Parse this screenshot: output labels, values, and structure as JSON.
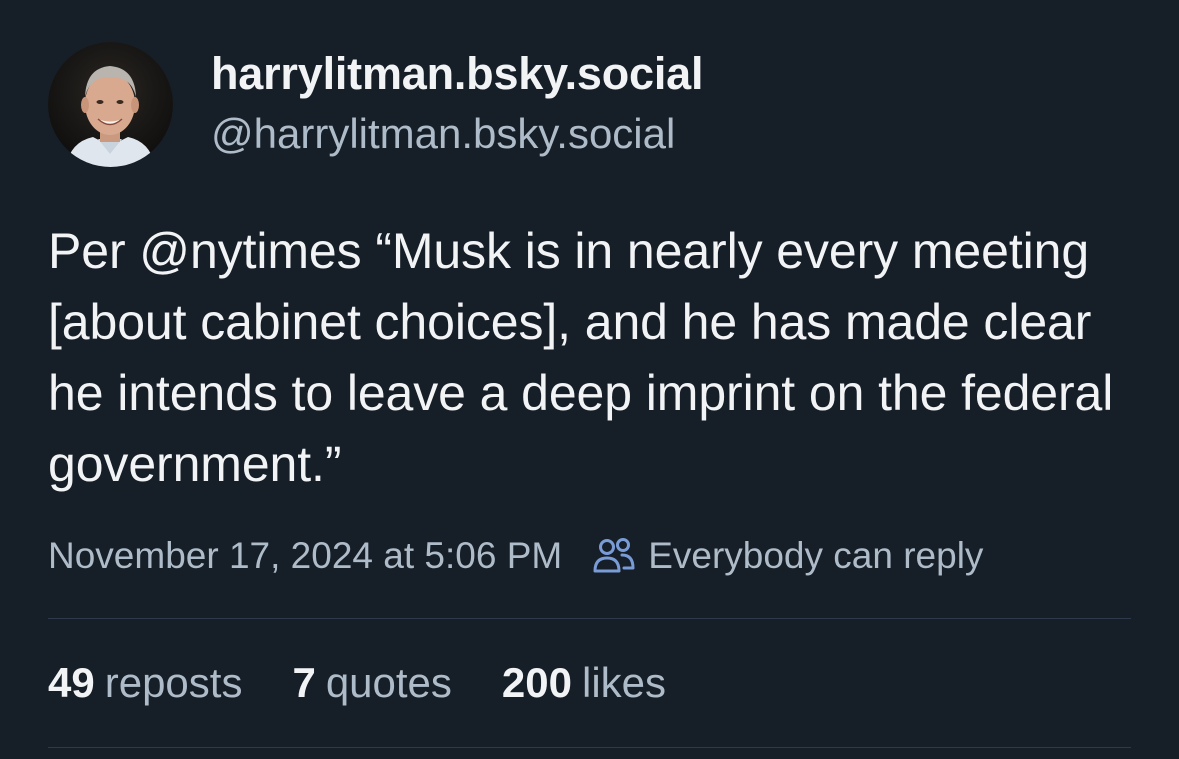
{
  "author": {
    "display_name": "harrylitman.bsky.social",
    "handle": "@harrylitman.bsky.social"
  },
  "post": {
    "text": "Per @nytimes “Musk is in nearly every meeting [about cabinet choices], and he has made clear he intends to leave a deep imprint on the federal government.”",
    "timestamp": "November 17, 2024 at 5:06 PM",
    "reply_setting": "Everybody can reply"
  },
  "stats": {
    "reposts": {
      "count": "49",
      "label": "reposts"
    },
    "quotes": {
      "count": "7",
      "label": "quotes"
    },
    "likes": {
      "count": "200",
      "label": "likes"
    }
  },
  "icons": {
    "reply_setting_icon": "people-icon"
  },
  "colors": {
    "background": "#161e27",
    "primary_text": "#f1f3f5",
    "secondary_text": "#aebbc9",
    "divider": "#2c3a4b",
    "icon_accent": "#7a9cd6"
  }
}
